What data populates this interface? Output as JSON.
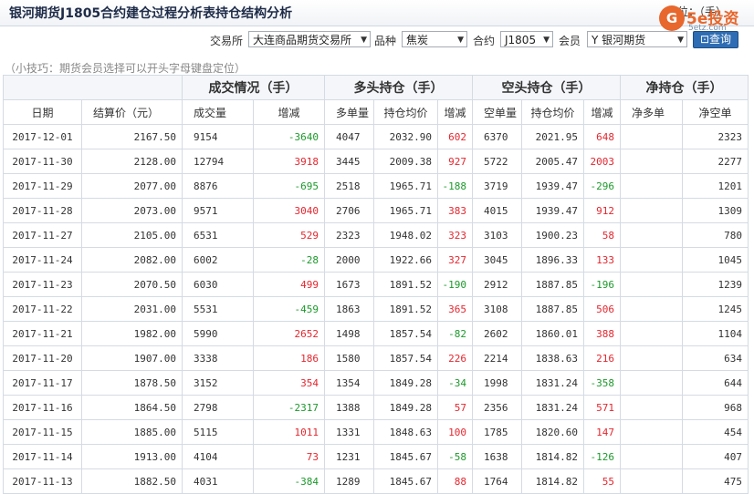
{
  "header": {
    "title": "银河期货J1805合约建仓过程分析表持仓结构分析",
    "unit_note": "单位：（手）",
    "logo": {
      "mark": "G",
      "brand": "5e投资",
      "url": "5etz.com"
    }
  },
  "filters": {
    "exchange_label": "交易所",
    "exchange_value": "大连商品期货交易所",
    "product_label": "品种",
    "product_value": "焦炭",
    "contract_label": "合约",
    "contract_value": "J1805",
    "member_label": "会员",
    "member_value": "Y 银河期货",
    "query_label": "查询"
  },
  "tip": "（小技巧：期货会员选择可以开头字母键盘定位）",
  "table": {
    "groups": [
      "成交情况（手）",
      "多头持仓（手）",
      "空头持仓（手）",
      "净持仓（手）"
    ],
    "columns": [
      "日期",
      "结算价（元）",
      "成交量",
      "增减",
      "多单量",
      "持仓均价",
      "增减",
      "空单量",
      "持仓均价",
      "增减",
      "净多单",
      "净空单"
    ],
    "rows": [
      [
        "2017-12-01",
        "2167.50",
        "9154",
        "-3640",
        "4047",
        "2032.90",
        "602",
        "6370",
        "2021.95",
        "648",
        "",
        "2323"
      ],
      [
        "2017-11-30",
        "2128.00",
        "12794",
        "3918",
        "3445",
        "2009.38",
        "927",
        "5722",
        "2005.47",
        "2003",
        "",
        "2277"
      ],
      [
        "2017-11-29",
        "2077.00",
        "8876",
        "-695",
        "2518",
        "1965.71",
        "-188",
        "3719",
        "1939.47",
        "-296",
        "",
        "1201"
      ],
      [
        "2017-11-28",
        "2073.00",
        "9571",
        "3040",
        "2706",
        "1965.71",
        "383",
        "4015",
        "1939.47",
        "912",
        "",
        "1309"
      ],
      [
        "2017-11-27",
        "2105.00",
        "6531",
        "529",
        "2323",
        "1948.02",
        "323",
        "3103",
        "1900.23",
        "58",
        "",
        "780"
      ],
      [
        "2017-11-24",
        "2082.00",
        "6002",
        "-28",
        "2000",
        "1922.66",
        "327",
        "3045",
        "1896.33",
        "133",
        "",
        "1045"
      ],
      [
        "2017-11-23",
        "2070.50",
        "6030",
        "499",
        "1673",
        "1891.52",
        "-190",
        "2912",
        "1887.85",
        "-196",
        "",
        "1239"
      ],
      [
        "2017-11-22",
        "2031.00",
        "5531",
        "-459",
        "1863",
        "1891.52",
        "365",
        "3108",
        "1887.85",
        "506",
        "",
        "1245"
      ],
      [
        "2017-11-21",
        "1982.00",
        "5990",
        "2652",
        "1498",
        "1857.54",
        "-82",
        "2602",
        "1860.01",
        "388",
        "",
        "1104"
      ],
      [
        "2017-11-20",
        "1907.00",
        "3338",
        "186",
        "1580",
        "1857.54",
        "226",
        "2214",
        "1838.63",
        "216",
        "",
        "634"
      ],
      [
        "2017-11-17",
        "1878.50",
        "3152",
        "354",
        "1354",
        "1849.28",
        "-34",
        "1998",
        "1831.24",
        "-358",
        "",
        "644"
      ],
      [
        "2017-11-16",
        "1864.50",
        "2798",
        "-2317",
        "1388",
        "1849.28",
        "57",
        "2356",
        "1831.24",
        "571",
        "",
        "968"
      ],
      [
        "2017-11-15",
        "1885.00",
        "5115",
        "1011",
        "1331",
        "1848.63",
        "100",
        "1785",
        "1820.60",
        "147",
        "",
        "454"
      ],
      [
        "2017-11-14",
        "1913.00",
        "4104",
        "73",
        "1231",
        "1845.67",
        "-58",
        "1638",
        "1814.82",
        "-126",
        "",
        "407"
      ],
      [
        "2017-11-13",
        "1882.50",
        "4031",
        "-384",
        "1289",
        "1845.67",
        "88",
        "1764",
        "1814.82",
        "55",
        "",
        "475"
      ]
    ],
    "colors": {
      "increase": "#e5262e",
      "decrease": "#1b9a2a",
      "header_bg": "#f4f6f9",
      "border": "#d4dbe4"
    }
  }
}
